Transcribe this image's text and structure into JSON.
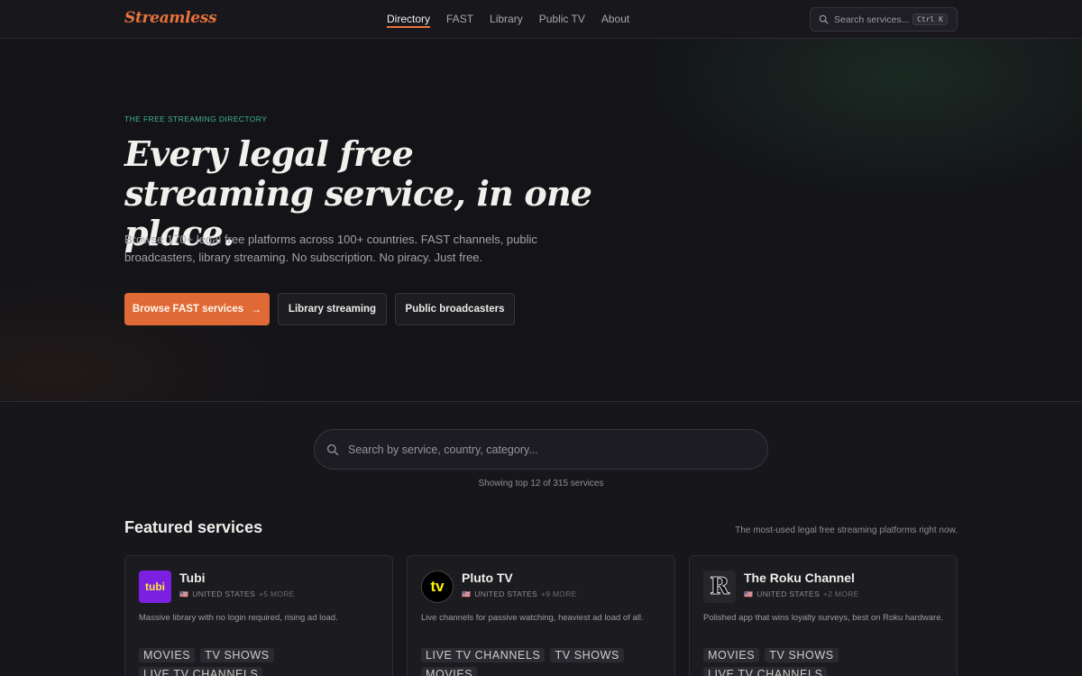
{
  "brand": "Streamless",
  "nav": [
    "Directory",
    "FAST",
    "Library",
    "Public TV",
    "About"
  ],
  "topsearch": {
    "placeholder": "Search services...",
    "shortcut": "Ctrl K"
  },
  "hero": {
    "eyebrow": "THE FREE STREAMING DIRECTORY",
    "headline": "Every legal free streaming service, in one place.",
    "lede": "Browse 170+ legal free platforms across 100+ countries. FAST channels, public broadcasters, library streaming. No subscription. No piracy. Just free.",
    "buttons": {
      "primary": "Browse FAST services",
      "library": "Library streaming",
      "public": "Public broadcasters"
    }
  },
  "search": {
    "placeholder": "Search by service, country, category...",
    "showing": "Showing top 12 of 315 services"
  },
  "featured": {
    "title": "Featured services",
    "note": "The most-used legal free streaming platforms right now.",
    "cards": [
      {
        "name": "Tubi",
        "logo_text": "tubi",
        "country": "UNITED STATES",
        "more": "+5 MORE",
        "desc": "Massive library with no login required, rising ad load.",
        "tags": [
          "MOVIES",
          "TV SHOWS",
          "LIVE TV CHANNELS"
        ]
      },
      {
        "name": "Pluto TV",
        "logo_text": "tv",
        "country": "UNITED STATES",
        "more": "+9 MORE",
        "desc": "Live channels for passive watching, heaviest ad load of all.",
        "tags": [
          "LIVE TV CHANNELS",
          "TV SHOWS",
          "MOVIES"
        ]
      },
      {
        "name": "The Roku Channel",
        "logo_text": "R",
        "country": "UNITED STATES",
        "more": "+2 MORE",
        "desc": "Polished app that wins loyalty surveys, best on Roku hardware.",
        "tags": [
          "MOVIES",
          "TV SHOWS",
          "LIVE TV CHANNELS"
        ]
      }
    ]
  },
  "colors": {
    "accent": "#e06a35",
    "eyebrow": "#41b48a",
    "background": "#16161b"
  }
}
